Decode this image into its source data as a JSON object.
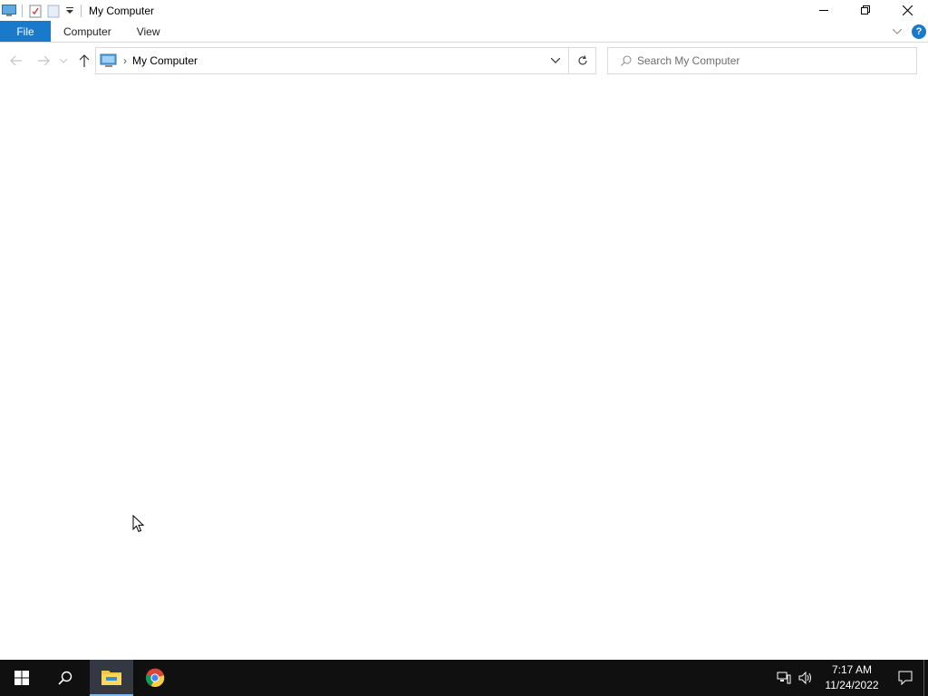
{
  "window": {
    "title": "My Computer"
  },
  "ribbon": {
    "tabs": [
      {
        "label": "File"
      },
      {
        "label": "Computer"
      },
      {
        "label": "View"
      }
    ],
    "help_label": "?"
  },
  "address_bar": {
    "path": "My Computer",
    "separator": "›"
  },
  "search": {
    "placeholder": "Search My Computer"
  },
  "taskbar": {
    "time": "7:17 AM",
    "date": "11/24/2022"
  },
  "colors": {
    "accent": "#1979ca",
    "taskbar": "#101010",
    "taskbar_active": "#333842"
  }
}
